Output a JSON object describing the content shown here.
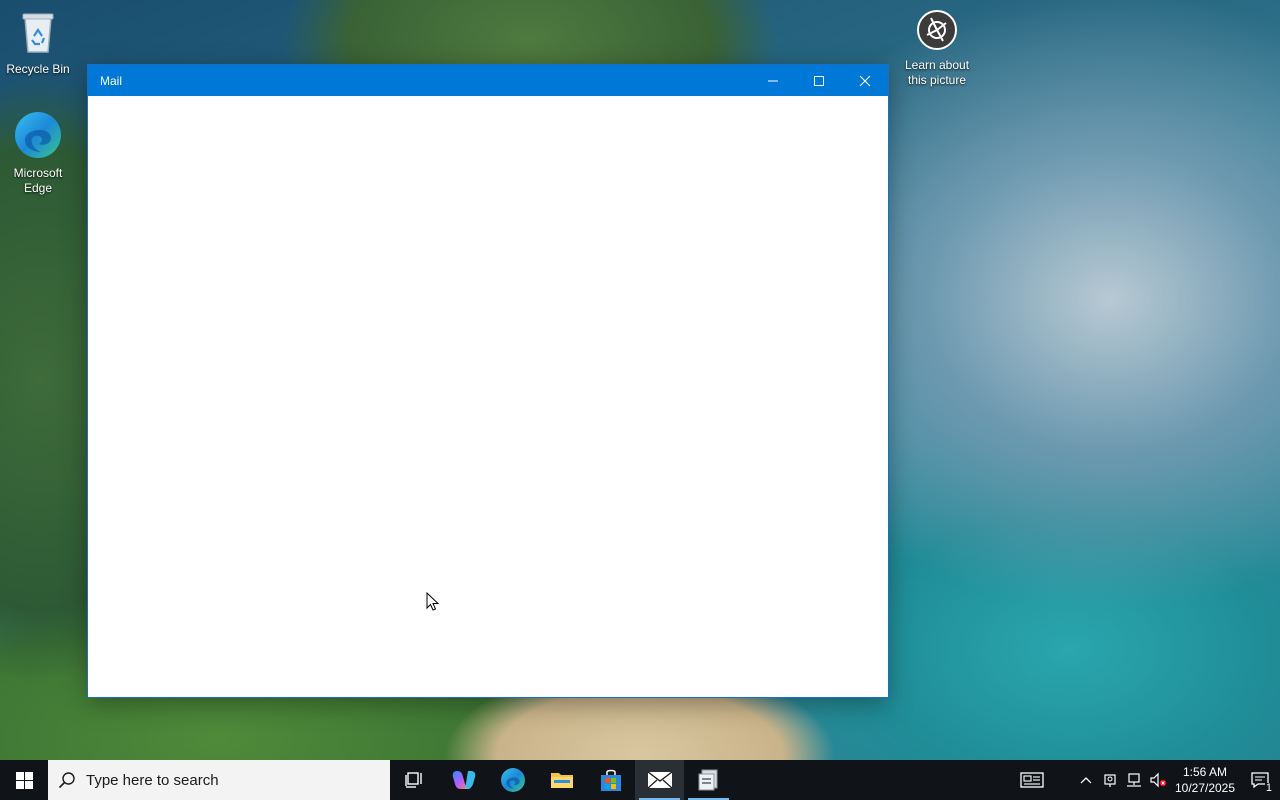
{
  "desktop": {
    "icons": [
      {
        "label": "Recycle Bin",
        "icon": "recycle-bin-icon"
      },
      {
        "label": "Microsoft Edge",
        "icon": "edge-icon"
      },
      {
        "label": "Learn about this picture",
        "icon": "camera-icon"
      }
    ]
  },
  "window": {
    "title": "Mail",
    "buttons": {
      "minimize": "minimize-icon",
      "maximize": "maximize-icon",
      "close": "close-icon"
    }
  },
  "taskbar": {
    "search_placeholder": "Type here to search",
    "apps": [
      {
        "name": "task-view",
        "icon": "task-view-icon"
      },
      {
        "name": "copilot",
        "icon": "copilot-icon"
      },
      {
        "name": "edge",
        "icon": "edge-icon"
      },
      {
        "name": "file-explorer",
        "icon": "folder-icon"
      },
      {
        "name": "store",
        "icon": "store-icon"
      },
      {
        "name": "mail",
        "icon": "mail-icon",
        "active": true
      },
      {
        "name": "other-app",
        "icon": "app-icon"
      }
    ],
    "tray": {
      "time": "1:56 AM",
      "date": "10/27/2025",
      "notifications_count": "1"
    }
  },
  "colors": {
    "accent": "#0078d7",
    "taskbar": "#101418",
    "search_box": "#f3f3f3"
  }
}
